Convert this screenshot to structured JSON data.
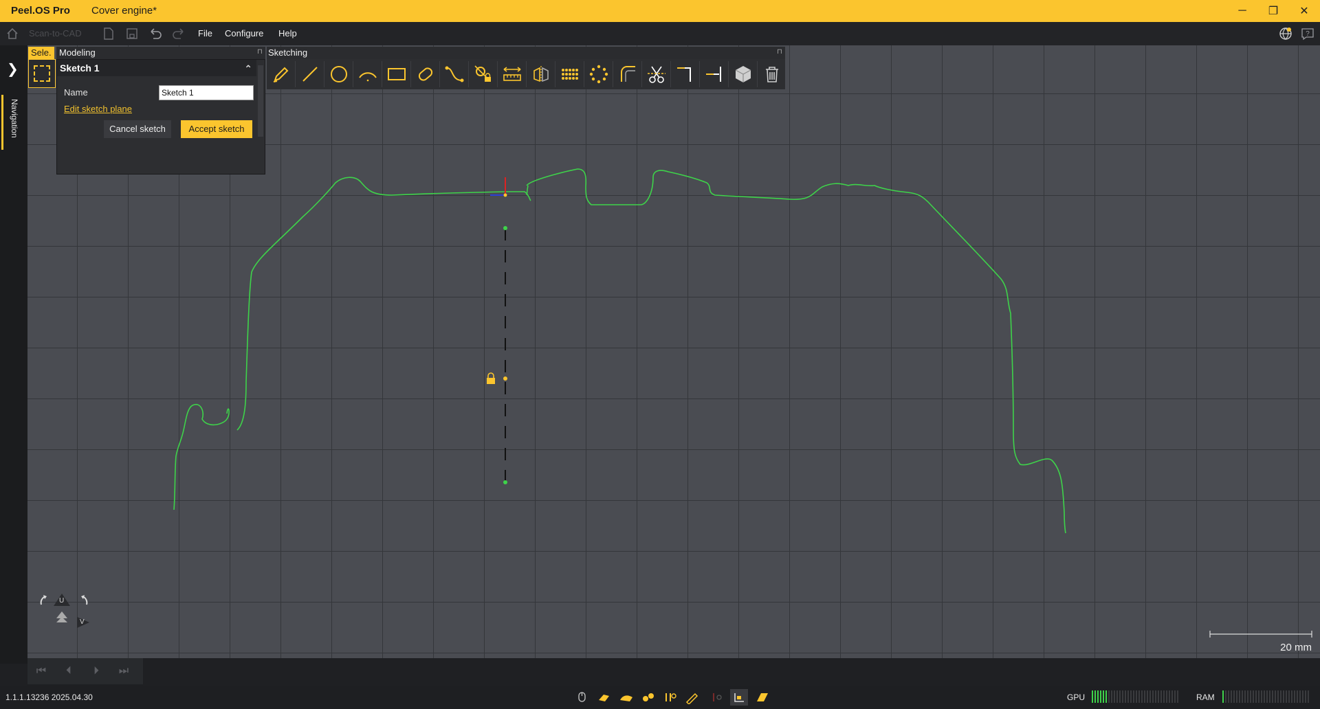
{
  "titlebar": {
    "app_name": "Peel.OS Pro",
    "document": "Cover engine*"
  },
  "menubar": {
    "breadcrumb": "Scan-to-CAD",
    "items": [
      "File",
      "Configure",
      "Help"
    ]
  },
  "left_rail": {
    "nav_tab": "Navigation"
  },
  "modeling": {
    "sel_tab": "Sele.",
    "title": "Modeling",
    "sketch_title": "Sketch 1",
    "name_label": "Name",
    "name_value": "Sketch 1",
    "edit_plane": "Edit sketch plane",
    "cancel": "Cancel sketch",
    "accept": "Accept sketch"
  },
  "sketching": {
    "title": "Sketching",
    "tools": [
      "pencil-icon",
      "line-icon",
      "circle-icon",
      "arc-icon",
      "rectangle-icon",
      "slot-icon",
      "spline-icon",
      "constraint-lock-icon",
      "dimension-icon",
      "mirror-icon",
      "grid-pattern-icon",
      "circular-pattern-icon",
      "fillet-icon",
      "trim-icon",
      "corner-icon",
      "extend-icon",
      "cube-icon",
      "delete-icon"
    ]
  },
  "navctrl": {
    "u": "U",
    "v": "V"
  },
  "scale": {
    "label": "20 mm"
  },
  "status": {
    "version": "1.1.1.13236 2025.04.30",
    "gpu_label": "GPU",
    "ram_label": "RAM",
    "gpu_level": 0.18,
    "ram_level": 0.04
  },
  "colors": {
    "accent": "#fbc52e",
    "curve": "#3ed34a",
    "viewport": "#4a4c52"
  }
}
